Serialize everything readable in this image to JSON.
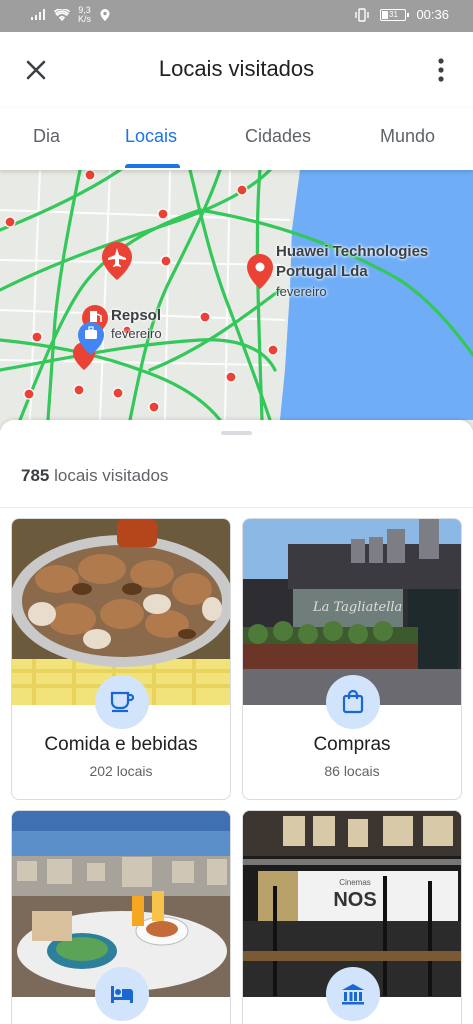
{
  "status": {
    "net_speed_top": "9,3",
    "net_speed_bottom": "K/s",
    "battery": "31",
    "time": "00:36"
  },
  "header": {
    "title": "Locais visitados"
  },
  "tabs": [
    {
      "label": "Dia",
      "active": false
    },
    {
      "label": "Locais",
      "active": true
    },
    {
      "label": "Cidades",
      "active": false
    },
    {
      "label": "Mundo",
      "active": false
    }
  ],
  "map": {
    "places": [
      {
        "name": "Huawei Technologies",
        "name2": "Portugal Lda",
        "date": "fevereiro"
      },
      {
        "name": "Repsol",
        "date": "fevereiro"
      }
    ]
  },
  "summary": {
    "count": "785",
    "count_label": "locais visitados"
  },
  "categories": [
    {
      "name": "Comida e bebidas",
      "count": "202 locais",
      "icon": "cup-icon"
    },
    {
      "name": "Compras",
      "count": "86 locais",
      "icon": "shopping-bag-icon"
    },
    {
      "name": "",
      "count": "",
      "icon": "bed-icon"
    },
    {
      "name": "",
      "count": "",
      "icon": "museum-icon"
    }
  ],
  "colors": {
    "accent": "#1a73e8",
    "pin": "#ea4335",
    "road": "#34c759",
    "water": "#4fa3ef",
    "badge": "#d2e3fc"
  }
}
